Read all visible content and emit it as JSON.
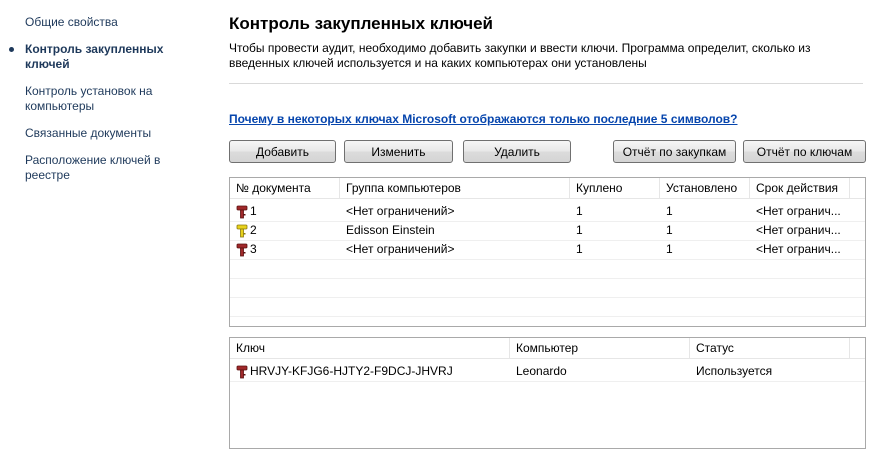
{
  "sidebar": {
    "items": [
      {
        "label": "Общие свойства",
        "active": false
      },
      {
        "label": "Контроль закупленных ключей",
        "active": true
      },
      {
        "label": "Контроль установок на компьютеры",
        "active": false
      },
      {
        "label": "Связанные документы",
        "active": false
      },
      {
        "label": "Расположение ключей в реестре",
        "active": false
      }
    ]
  },
  "main": {
    "title": "Контроль закупленных ключей",
    "description": "Чтобы провести аудит, необходимо добавить закупки и ввести ключи. Программа определит, сколько из введенных ключей используется и на каких компьютерах они установлены",
    "help_link": "Почему в некоторых ключах Microsoft отображаются только последние 5 символов?",
    "buttons": {
      "add": "Добавить",
      "edit": "Изменить",
      "delete": "Удалить",
      "report_purchases": "Отчёт по закупкам",
      "report_keys": "Отчёт по ключам"
    }
  },
  "purchases": {
    "headers": [
      "№ документа",
      "Группа компьютеров",
      "Куплено",
      "Установлено",
      "Срок действия"
    ],
    "rows": [
      {
        "icon": "red-key-icon",
        "doc": "1",
        "group": "<Нет ограничений>",
        "bought": "1",
        "installed": "1",
        "expiry": "<Нет огранич..."
      },
      {
        "icon": "yellow-key-icon",
        "doc": "2",
        "group": "Edisson Einstein",
        "bought": "1",
        "installed": "1",
        "expiry": "<Нет огранич..."
      },
      {
        "icon": "red-key-icon",
        "doc": "3",
        "group": "<Нет ограничений>",
        "bought": "1",
        "installed": "1",
        "expiry": "<Нет огранич..."
      }
    ]
  },
  "keys": {
    "headers": [
      "Ключ",
      "Компьютер",
      "Статус"
    ],
    "rows": [
      {
        "icon": "red-key-icon",
        "key": "HRVJY-KFJG6-HJTY2-F9DCJ-JHVRJ",
        "computer": "Leonardo",
        "status": "Используется"
      }
    ]
  },
  "colors": {
    "link": "#0645ad",
    "nav": "#1e395b",
    "key_red": "#a0282a",
    "key_yellow": "#e8d21a"
  }
}
